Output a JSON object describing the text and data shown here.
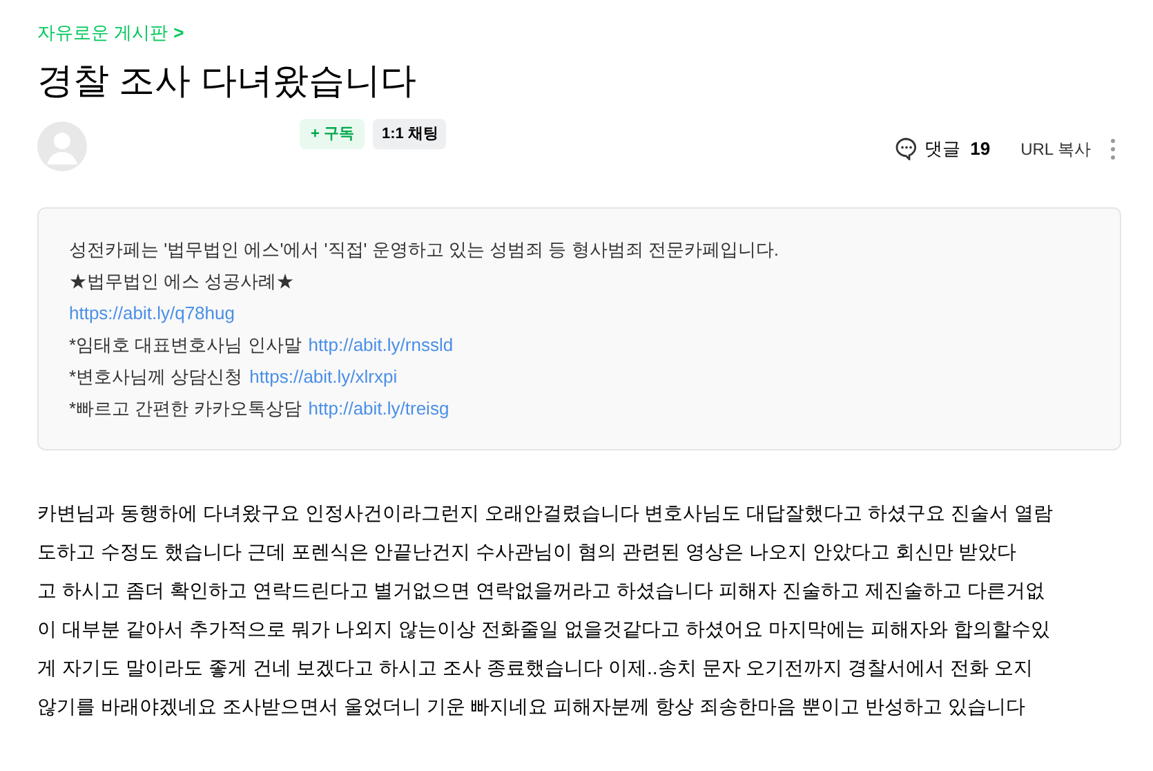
{
  "board": {
    "label": "자유로운 게시판",
    "arrow": ">"
  },
  "title": "경찰 조사 다녀왔습니다",
  "author": {
    "buttons": [
      {
        "kind": "subscribe",
        "label": "구독",
        "icon": "+"
      },
      {
        "kind": "chat",
        "label": "1:1 채팅"
      }
    ]
  },
  "actions": {
    "comments_label": "댓글",
    "comments_count": "19",
    "copy_url": "URL 복사"
  },
  "notice": {
    "lines": [
      {
        "text": "성전카페는 '법무법인 에스'에서 '직접' 운영하고 있는 성범죄 등 형사범죄 전문카페입니다."
      },
      {
        "text": "★법무법인 에스 성공사례★"
      },
      {
        "link": "https://abit.ly/q78hug"
      },
      {
        "text": "*임태호 대표변호사님 인사말",
        "link": "http://abit.ly/rnssld"
      },
      {
        "text": "*변호사님께 상담신청",
        "link": "https://abit.ly/xlrxpi"
      },
      {
        "text": "*빠르고 간편한 카카오톡상담",
        "link": "http://abit.ly/treisg"
      }
    ]
  },
  "body": {
    "lines": [
      "카변님과 동행하에 다녀왔구요 인정사건이라그런지 오래안걸렸습니다 변호사님도 대답잘했다고 하셨구요 진술서 열람",
      "도하고 수정도 했습니다 근데 포렌식은 안끝난건지 수사관님이   혐의 관련된 영상은 나오지 안았다고 회신만 받았다",
      "고 하시고 좀더 확인하고 연락드린다고 별거없으면 연락없을꺼라고 하셨습니다 피해자 진술하고 제진술하고 다른거없",
      "이 대부분 같아서 추가적으로 뭐가 나외지 않는이상 전화줄일 없을것같다고 하셨어요 마지막에는 피해자와 합의할수있",
      "게 자기도 말이라도 좋게 건네 보겠다고 하시고 조사 종료했습니다 이제..송치 문자 오기전까지 경찰서에서 전화 오지",
      "않기를 바래야겠네요 조사받으면서  울었더니 기운 빠지네요 피해자분께 항상 죄송한마음 뿐이고 반성하고 있습니다"
    ]
  }
}
